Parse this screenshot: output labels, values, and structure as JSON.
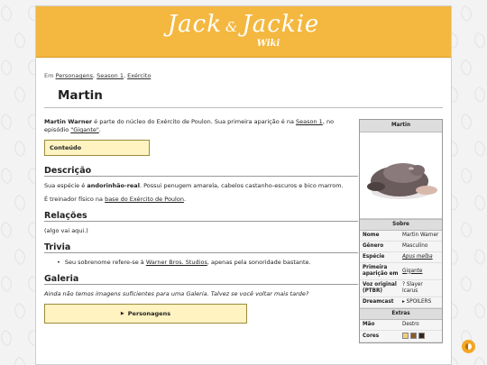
{
  "site": {
    "logo_main": "Jack",
    "logo_amp": "&",
    "logo_second": "Jackie",
    "logo_sub": "Wiki"
  },
  "breadcrumb": {
    "prefix": "Em",
    "items": [
      "Personagens",
      "Season 1",
      "Exército"
    ],
    "separator": ","
  },
  "page_title": "Martin",
  "intro": {
    "name_bold": "Martin Warner",
    "text1": " é parte do núcleo do Exército de Poulon. Sua primeira aparição é na ",
    "link1": "Season 1",
    "text2": ", no episódio ",
    "link2": "\"Gigante\"",
    "text3": "."
  },
  "toc_label": "Conteúdo",
  "sections": {
    "descricao": {
      "heading": "Descrição",
      "p1_pre": "Sua espécie é ",
      "p1_bold": "andorinhão-real",
      "p1_post": ". Possui penugem amarela, cabelos castanho-escuros e bico marrom.",
      "p2_pre": "É treinador físico na ",
      "p2_link": "base do Exército de Poulon",
      "p2_post": "."
    },
    "relacoes": {
      "heading": "Relações",
      "text": "(algo vai aqui.)"
    },
    "trivia": {
      "heading": "Trivia",
      "item_pre": "Seu sobrenome refere-se à ",
      "item_link": "Warner Bros. Studios",
      "item_post": ", apenas pela sonoridade bastante."
    },
    "galeria": {
      "heading": "Galeria",
      "note": "Ainda não temos imagens suficientes para uma Galeria. Talvez se você voltar mais tarde?",
      "collapsible_label": "Personagens",
      "collapsible_icon": "triangle-right"
    }
  },
  "infobox": {
    "title": "Martin",
    "sobre_heading": "Sobre",
    "rows": [
      {
        "label": "Nome",
        "value": "Martin Warner"
      },
      {
        "label": "Gênero",
        "value": "Masculino"
      },
      {
        "label": "Espécie",
        "value": "Apus melba"
      },
      {
        "label": "Primeira aparição em",
        "value": "Gigante"
      },
      {
        "label": "Voz original (PTBR)",
        "value": "? Slayer Icarus"
      },
      {
        "label": "Dreamcast",
        "value": "▸ SPOILERS"
      }
    ],
    "extras_heading": "Extras",
    "extras": [
      {
        "label": "Mão",
        "value": "Destro"
      },
      {
        "label": "Cores",
        "value": ""
      }
    ],
    "colors": [
      "#f2cf7a",
      "#8a5a2b",
      "#3a2418"
    ]
  },
  "colors": {
    "header": "#f4b840",
    "toc_bg": "#fff3c2",
    "theme_button": "#f4a623"
  }
}
